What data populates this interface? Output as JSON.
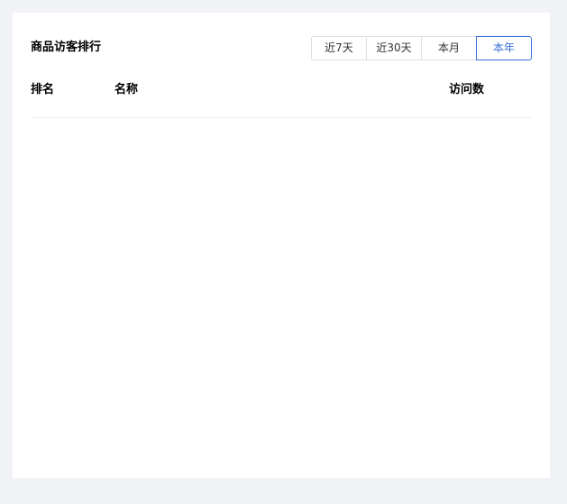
{
  "card": {
    "title": "商品访客排行"
  },
  "range_tabs": [
    {
      "label": "近7天",
      "active": false
    },
    {
      "label": "近30天",
      "active": false
    },
    {
      "label": "本月",
      "active": false
    },
    {
      "label": "本年",
      "active": true
    }
  ],
  "table": {
    "columns": {
      "rank": "排名",
      "name": "名称",
      "visits": "访问数"
    },
    "rows": []
  },
  "colors": {
    "accent": "#3a6fd8",
    "page_background": "#f0f2f5",
    "card_background": "#ffffff",
    "border": "#dcdfe6"
  }
}
